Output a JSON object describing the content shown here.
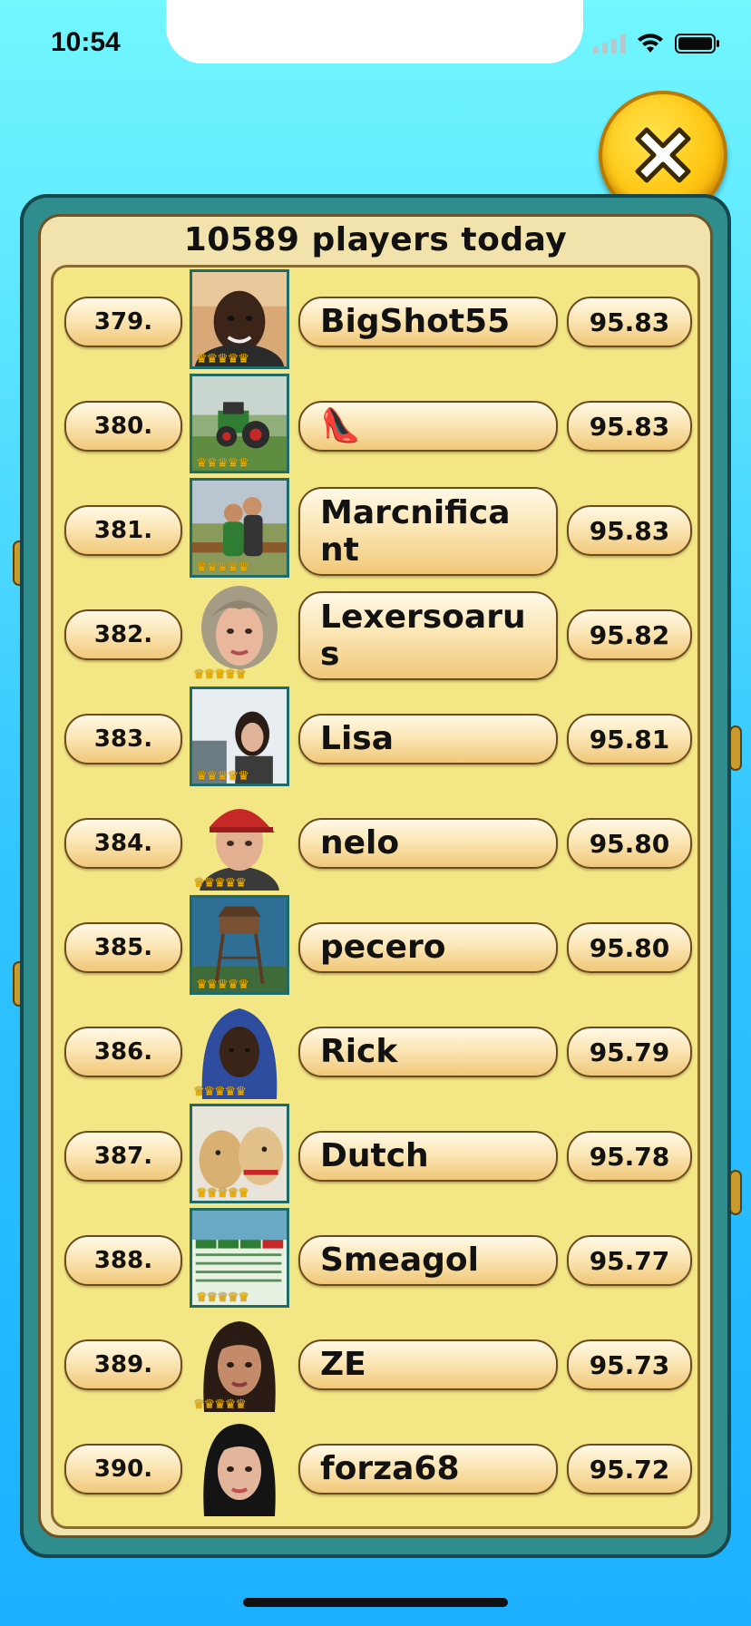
{
  "status_bar": {
    "time": "10:54"
  },
  "panel": {
    "title": "10589 players today"
  },
  "rows": [
    {
      "rank": "379.",
      "name": "BigShot55",
      "score": "95.83",
      "avatar": "man-photo",
      "crowns": "♛♛♛♛♛"
    },
    {
      "rank": "380.",
      "name": "👠",
      "score": "95.83",
      "avatar": "tractor-photo",
      "crowns": "♛♛♛♛♛"
    },
    {
      "rank": "381.",
      "name": "Marcnifica nt",
      "score": "95.83",
      "avatar": "couple-photo",
      "crowns": "♛♛♛♛♛"
    },
    {
      "rank": "382.",
      "name": "Lexersoaru s",
      "score": "95.82",
      "avatar": "blonde-woman-avatar",
      "crowns": "♛♛♛♛♛"
    },
    {
      "rank": "383.",
      "name": "Lisa",
      "score": "95.81",
      "avatar": "woman-selfie-photo",
      "crowns": "♛♛♛♛♛"
    },
    {
      "rank": "384.",
      "name": "nelo",
      "score": "95.80",
      "avatar": "red-cap-avatar",
      "crowns": "♛♛♛♛♛"
    },
    {
      "rank": "385.",
      "name": "pecero",
      "score": "95.80",
      "avatar": "watchtower-photo",
      "crowns": "♛♛♛♛♛"
    },
    {
      "rank": "386.",
      "name": "Rick",
      "score": "95.79",
      "avatar": "hooded-avatar",
      "crowns": "♛♛♛♛♛"
    },
    {
      "rank": "387.",
      "name": "Dutch",
      "score": "95.78",
      "avatar": "dogs-photo",
      "crowns": "♛♛♛♛♛"
    },
    {
      "rank": "388.",
      "name": "Smeagol",
      "score": "95.77",
      "avatar": "score-table-photo",
      "crowns": "♛♛♛♛♛"
    },
    {
      "rank": "389.",
      "name": "ZE",
      "score": "95.73",
      "avatar": "dark-hair-woman-avatar",
      "crowns": "♛♛♛♛♛"
    },
    {
      "rank": "390.",
      "name": "forza68",
      "score": "95.72",
      "avatar": "black-hair-woman-avatar",
      "crowns": ""
    }
  ],
  "colors": {
    "background_top": "#72f7ff",
    "background_bottom": "#1cb0ff",
    "panel_frame": "#2f8d8d",
    "list_background": "#f3e785",
    "close_button": "#ffc814"
  }
}
